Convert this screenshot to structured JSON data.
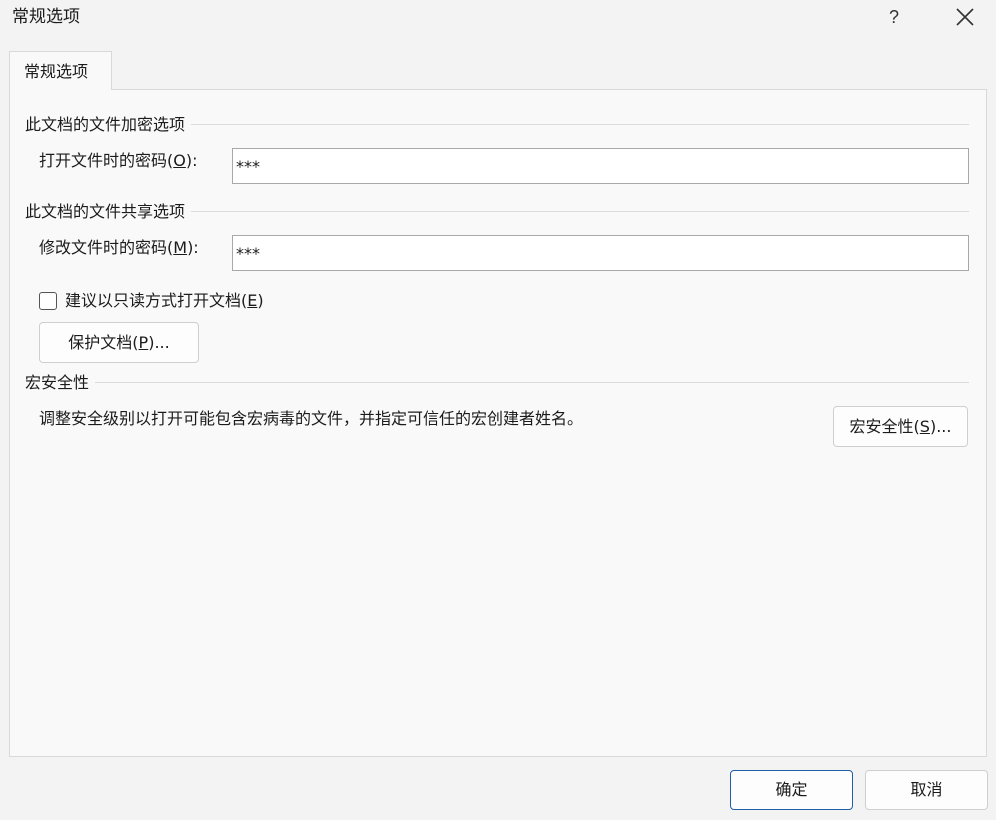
{
  "window": {
    "title": "常规选项",
    "help_label": "?"
  },
  "tab": {
    "label": "常规选项"
  },
  "encryption": {
    "group_title": "此文档的文件加密选项",
    "open_password_label_prefix": "打开文件时的密码(",
    "open_password_mnemonic": "O",
    "open_password_label_suffix": "):",
    "open_password_value": "***"
  },
  "sharing": {
    "group_title": "此文档的文件共享选项",
    "modify_password_label_prefix": "修改文件时的密码(",
    "modify_password_mnemonic": "M",
    "modify_password_label_suffix": "):",
    "modify_password_value": "***",
    "readonly_label_prefix": "建议以只读方式打开文档(",
    "readonly_mnemonic": "E",
    "readonly_label_suffix": ")",
    "readonly_checked": false,
    "protect_button_prefix": "保护文档(",
    "protect_button_mnemonic": "P",
    "protect_button_suffix": ")..."
  },
  "macro": {
    "group_title": "宏安全性",
    "description": "调整安全级别以打开可能包含宏病毒的文件，并指定可信任的宏创建者姓名。",
    "button_prefix": "宏安全性(",
    "button_mnemonic": "S",
    "button_suffix": ")..."
  },
  "footer": {
    "ok_label": "确定",
    "cancel_label": "取消"
  },
  "colors": {
    "primary_border": "#1f5fa8",
    "background": "#f3f3f3",
    "panel": "#f9f9f9"
  }
}
